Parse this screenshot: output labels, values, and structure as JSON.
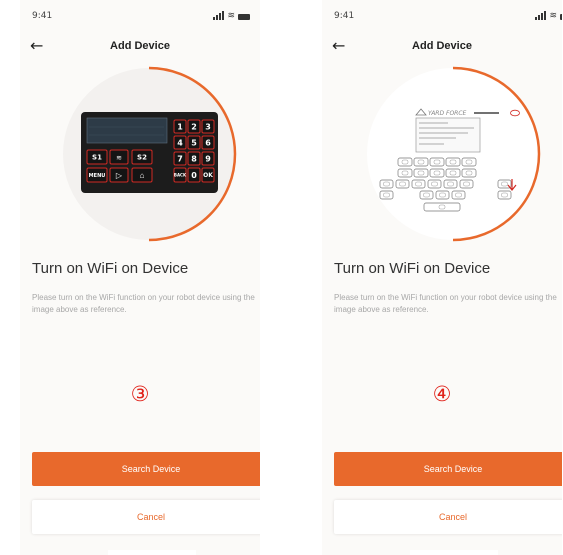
{
  "screens": [
    {
      "status": {
        "time": "9:41"
      },
      "nav": {
        "back_icon": "arrow-left-icon",
        "title": "Add Device"
      },
      "device_keys": [
        "1",
        "2",
        "3",
        "4",
        "5",
        "6",
        "7",
        "8",
        "9",
        "0",
        "S1",
        "S2",
        "MENU",
        "OK",
        "BACK"
      ],
      "headline": "Turn on WiFi on Device",
      "description": "Please turn on the WiFi function on your robot device using the image above as reference.",
      "step_marker": "③",
      "primary_button": "Search Device",
      "secondary_button": "Cancel"
    },
    {
      "status": {
        "time": "9:41"
      },
      "nav": {
        "back_icon": "arrow-left-icon",
        "title": "Add Device"
      },
      "device_brand": "YARD FORCE",
      "headline": "Turn on WiFi on Device",
      "description": "Please turn on the WiFi function on your robot device using the image above as reference.",
      "step_marker": "④",
      "primary_button": "Search Device",
      "secondary_button": "Cancel"
    }
  ],
  "colors": {
    "accent": "#e8692c",
    "step_marker": "#e0221a",
    "keypad_red": "#d12a23",
    "text_dark": "#333333",
    "text_muted": "#a8a8a8"
  }
}
